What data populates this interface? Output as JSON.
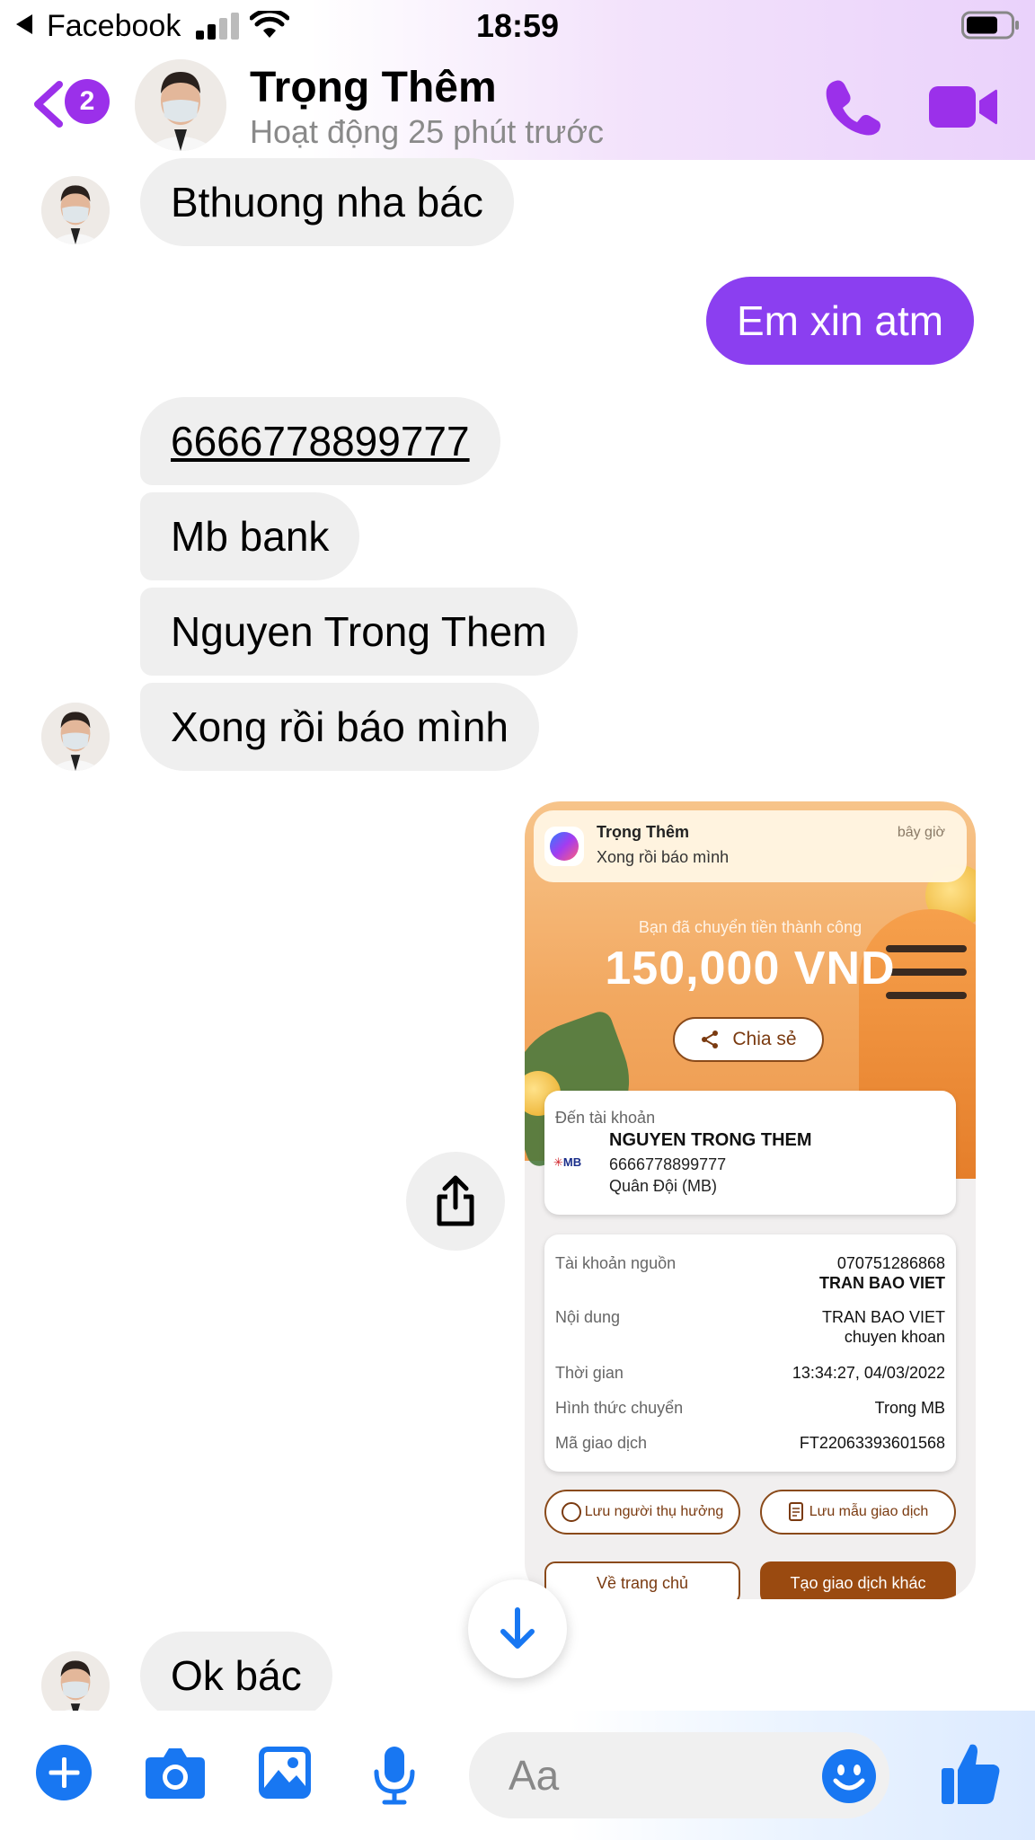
{
  "status_bar": {
    "back_app": "Facebook",
    "time": "18:59"
  },
  "header": {
    "unread_count": "2",
    "contact_name": "Trọng Thêm",
    "activity": "Hoạt động 25 phút trước"
  },
  "messages": [
    {
      "side": "in",
      "text": "Bthuong nha bác"
    },
    {
      "side": "out",
      "text": "Em xin atm"
    },
    {
      "side": "in",
      "text": "6666778899777"
    },
    {
      "side": "in",
      "text": "Mb bank"
    },
    {
      "side": "in",
      "text": "Nguyen Trong Them"
    },
    {
      "side": "in",
      "text": "Xong rồi báo mình"
    },
    {
      "side": "in",
      "text": "Ok bác"
    }
  ],
  "attachment": {
    "notification": {
      "title": "Trọng Thêm",
      "body": "Xong rồi báo mình",
      "time": "bây giờ"
    },
    "success_text": "Bạn đã chuyển tiền thành công",
    "amount": "150,000 VND",
    "share_label": "Chia sẻ",
    "recipient": {
      "label": "Đến tài khoản",
      "bank_logo": "MB",
      "name": "NGUYEN TRONG THEM",
      "account": "6666778899777",
      "bank": "Quân Đội (MB)"
    },
    "details": {
      "source_label": "Tài khoản nguồn",
      "source_account": "070751286868",
      "source_name": "TRAN BAO VIET",
      "content_label": "Nội dung",
      "content_line1": "TRAN BAO VIET",
      "content_line2": "chuyen khoan",
      "time_label": "Thời gian",
      "time_value": "13:34:27, 04/03/2022",
      "method_label": "Hình thức chuyển",
      "method_value": "Trong MB",
      "txn_label": "Mã giao dịch",
      "txn_value": "FT22063393601568"
    },
    "save_beneficiary": "Lưu người thụ hưởng",
    "save_template": "Lưu mẫu giao dịch",
    "home_button": "Về trang chủ",
    "new_txn_button": "Tạo giao dịch khác"
  },
  "composer": {
    "placeholder": "Aa"
  },
  "colors": {
    "messenger_purple": "#8b3ff0",
    "accent_blue": "#1877f2",
    "bubble_gray": "#efefef"
  }
}
